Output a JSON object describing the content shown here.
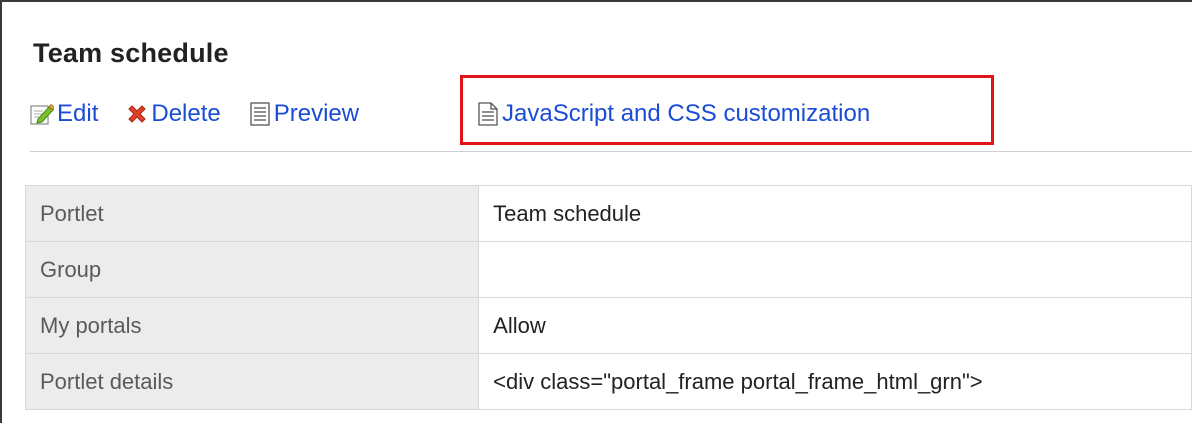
{
  "page": {
    "title": "Team schedule"
  },
  "toolbar": {
    "edit_label": "Edit",
    "delete_label": "Delete",
    "preview_label": "Preview",
    "js_css_label": "JavaScript and CSS customization"
  },
  "properties": [
    {
      "label": "Portlet",
      "value": "Team schedule"
    },
    {
      "label": "Group",
      "value": ""
    },
    {
      "label": "My portals",
      "value": "Allow"
    },
    {
      "label": "Portlet details",
      "value": "<div class=\"portal_frame portal_frame_html_grn\">"
    }
  ],
  "colors": {
    "link": "#1a4cd6",
    "highlight_border": "#e0151b",
    "label_bg": "#ececec"
  },
  "icons": {
    "edit": "edit-icon",
    "delete": "delete-icon",
    "preview": "document-icon",
    "js_css": "document-icon"
  }
}
